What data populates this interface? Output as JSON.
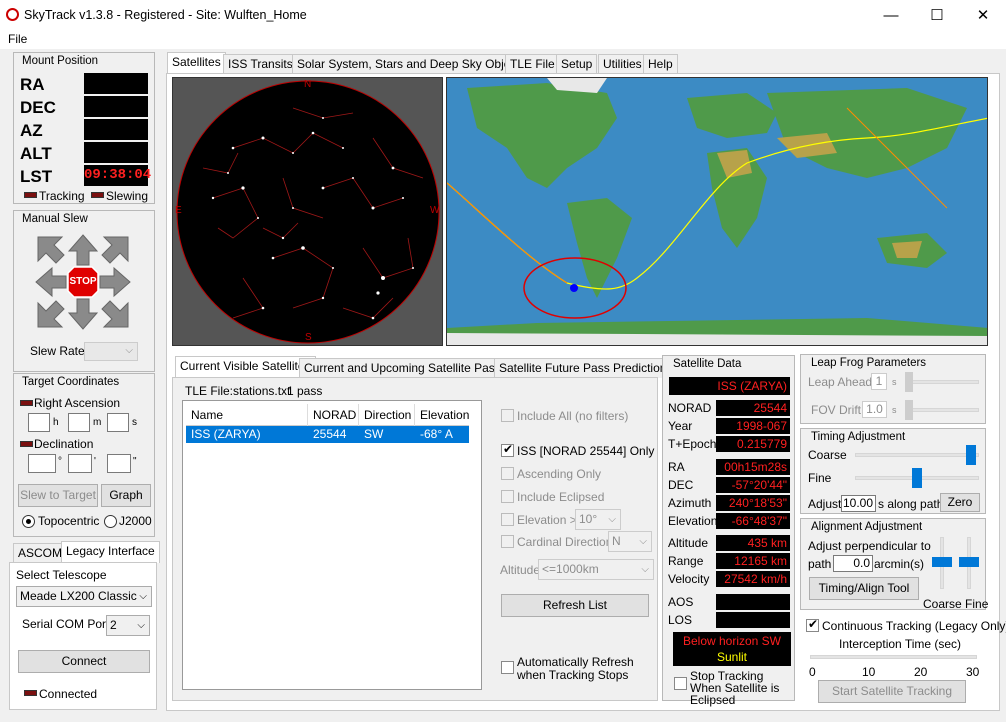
{
  "window": {
    "title": "SkyTrack v1.3.8 - Registered - Site: Wulften_Home",
    "minimize": "—",
    "maximize": "☐",
    "close": "✕"
  },
  "menu": {
    "file": "File"
  },
  "mount": {
    "title": "Mount Position",
    "ra_label": "RA",
    "dec_label": "DEC",
    "az_label": "AZ",
    "alt_label": "ALT",
    "lst_label": "LST",
    "ra": "",
    "dec": "",
    "az": "",
    "alt": "",
    "lst": "09:38:04",
    "tracking": "Tracking",
    "slewing": "Slewing"
  },
  "manual_slew": {
    "title": "Manual Slew",
    "stop": "STOP",
    "slew_rate_label": "Slew Rate",
    "slew_rate": ""
  },
  "target": {
    "title": "Target Coordinates",
    "ra_label": "Right Ascension",
    "dec_label": "Declination",
    "h": "h",
    "m": "m",
    "s": "s",
    "deg": "°",
    "min": "'",
    "sec": "\"",
    "slew_button": "Slew to Target",
    "graph_button": "Graph",
    "topocentric": "Topocentric",
    "j2000": "J2000"
  },
  "interface_tabs": {
    "ascom": "ASCOM",
    "legacy": "Legacy Interface"
  },
  "telescope": {
    "select_label": "Select Telescope",
    "selected": "Meade LX200 Classic",
    "com_label": "Serial COM Port",
    "com": "2",
    "connect": "Connect",
    "connected": "Connected"
  },
  "main_tabs": [
    "Satellites",
    "ISS Transits",
    "Solar System, Stars and Deep Sky Objects",
    "TLE File",
    "Setup",
    "Utilities",
    "Help"
  ],
  "sky_map": {
    "n": "N",
    "e": "E",
    "w": "W",
    "s": "S"
  },
  "sub_tabs": [
    "Current Visible Satellites",
    "Current and Upcoming Satellite Passes",
    "Satellite Future Pass Predictions"
  ],
  "tle_file": {
    "label": "TLE File:stations.txt",
    "passes": "1 pass"
  },
  "table": {
    "headers": [
      "Name",
      "NORAD",
      "Direction",
      "Elevation"
    ],
    "rows": [
      [
        "ISS (ZARYA)",
        "25544",
        "SW",
        "-68° A"
      ]
    ]
  },
  "filters": {
    "include_all": "Include All (no filters)",
    "iss_only": "ISS [NORAD 25544] Only",
    "ascending": "Ascending Only",
    "eclipsed": "Include Eclipsed",
    "elevation": "Elevation >",
    "elevation_value": "10°",
    "cardinal": "Cardinal Direction",
    "cardinal_value": "N",
    "altitude": "Altitude",
    "altitude_value": "<=1000km",
    "refresh": "Refresh List",
    "auto_refresh": "Automatically Refresh when Tracking Stops"
  },
  "sat_data": {
    "title": "Satellite Data",
    "name": "ISS (ZARYA)",
    "norad_label": "NORAD",
    "norad": "25544",
    "year_label": "Year",
    "year": "1998-067",
    "epoch_label": "T+Epoch",
    "epoch": "0.215779",
    "ra_label": "RA",
    "ra": "00h15m28s",
    "dec_label": "DEC",
    "dec": "-57°20'44\"",
    "az_label": "Azimuth",
    "az": "240°18'53\"",
    "el_label": "Elevation",
    "el": "-66°48'37\"",
    "alt_label": "Altitude",
    "alt": "435 km",
    "range_label": "Range",
    "range": "12165 km",
    "vel_label": "Velocity",
    "vel": "27542 km/h",
    "aos_label": "AOS",
    "aos": "",
    "los_label": "LOS",
    "los": "",
    "status1": "Below horizon SW",
    "status2": "Sunlit",
    "stop_eclipsed": "Stop Tracking When Satellite is Eclipsed"
  },
  "leapfrog": {
    "title": "Leap Frog Parameters",
    "ahead_label": "Leap Ahead",
    "ahead": "1",
    "ahead_unit": "s",
    "fov_label": "FOV Drift",
    "fov": "1.0",
    "fov_unit": "s"
  },
  "timing": {
    "title": "Timing Adjustment",
    "coarse": "Coarse",
    "fine": "Fine",
    "adjust_label": "Adjust",
    "adjust": "10.00",
    "adjust_unit": "s along path",
    "zero": "Zero",
    "coarse_level": 0.97,
    "fine_level": 0.5
  },
  "alignment": {
    "title": "Alignment Adjustment",
    "perp_label": "Adjust perpendicular to",
    "path_label": "path",
    "path": "0.0",
    "unit": "arcmin(s)",
    "tool": "Timing/Align Tool",
    "coarse_fine": "Coarse Fine"
  },
  "continuous": {
    "label": "Continuous Tracking (Legacy Only)",
    "intercept_label": "Interception Time (sec)",
    "ticks": [
      "0",
      "10",
      "20",
      "30"
    ],
    "start": "Start Satellite Tracking"
  },
  "colors": {
    "lcd_text": "#ff2020",
    "selection": "#0078d7",
    "status_text": "#ffff00"
  }
}
